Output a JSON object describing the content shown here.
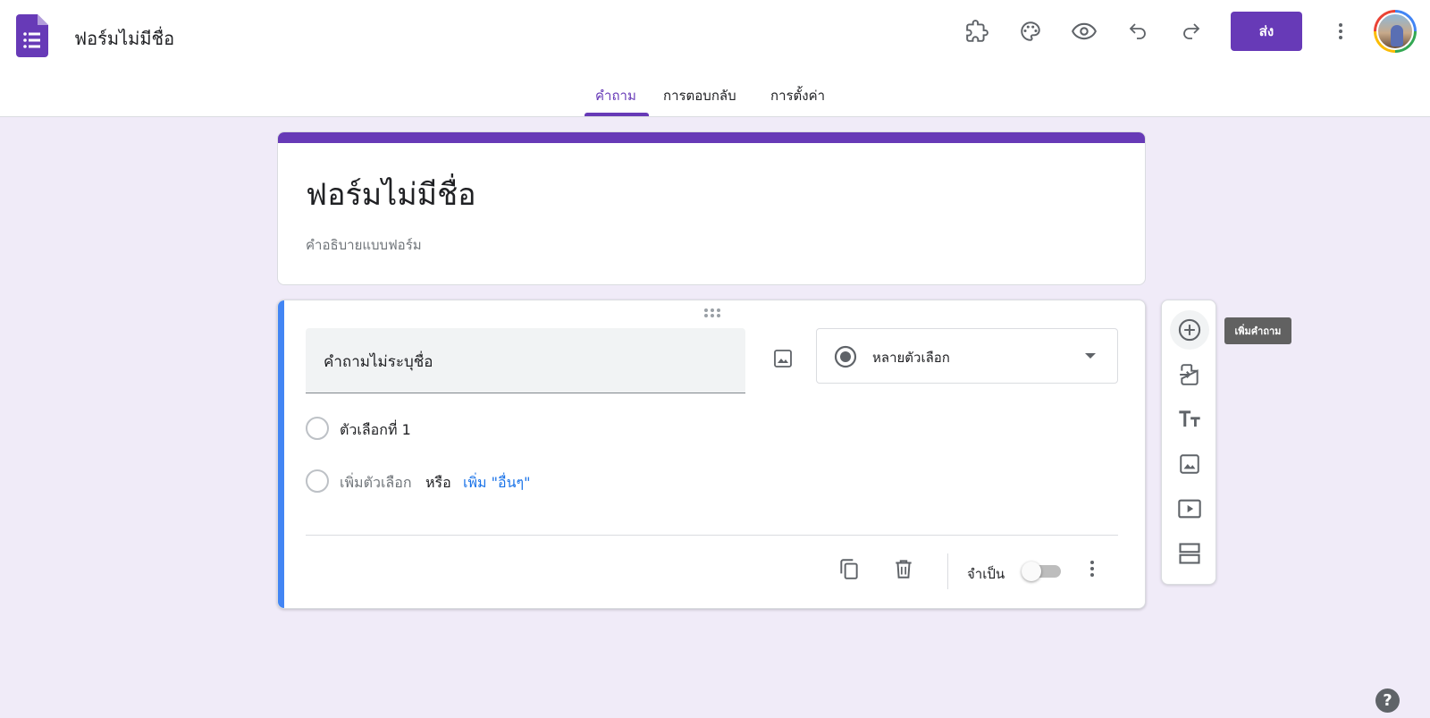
{
  "header": {
    "doc_title": "ฟอร์มไม่มีชื่อ",
    "send_label": "ส่ง",
    "toolbar_icons": [
      "addon-icon",
      "palette-icon",
      "preview-icon",
      "undo-icon",
      "redo-icon",
      "more-vert-icon"
    ]
  },
  "tabs": [
    {
      "label": "คำถาม",
      "active": true
    },
    {
      "label": "การตอบกลับ",
      "active": false
    },
    {
      "label": "การตั้งค่า",
      "active": false
    }
  ],
  "form": {
    "title": "ฟอร์มไม่มีชื่อ",
    "description_placeholder": "คำอธิบายแบบฟอร์ม"
  },
  "question": {
    "title": "คำถามไม่ระบุชื่อ",
    "type_label": "หลายตัวเลือก",
    "options": [
      "ตัวเลือกที่ 1"
    ],
    "add_option_label": "เพิ่มตัวเลือก",
    "or_label": "หรือ",
    "add_other_label": "เพิ่ม \"อื่นๆ\"",
    "required_label": "จำเป็น",
    "required": false
  },
  "side_toolbar": {
    "tooltip": "เพิ่มคำถาม",
    "items": [
      "add-question-icon",
      "import-questions-icon",
      "add-title-icon",
      "add-image-icon",
      "add-video-icon",
      "add-section-icon"
    ]
  },
  "colors": {
    "accent": "#673ab7",
    "background": "#f0ebf8",
    "active_question": "#4285f4",
    "link": "#1a73e8"
  }
}
